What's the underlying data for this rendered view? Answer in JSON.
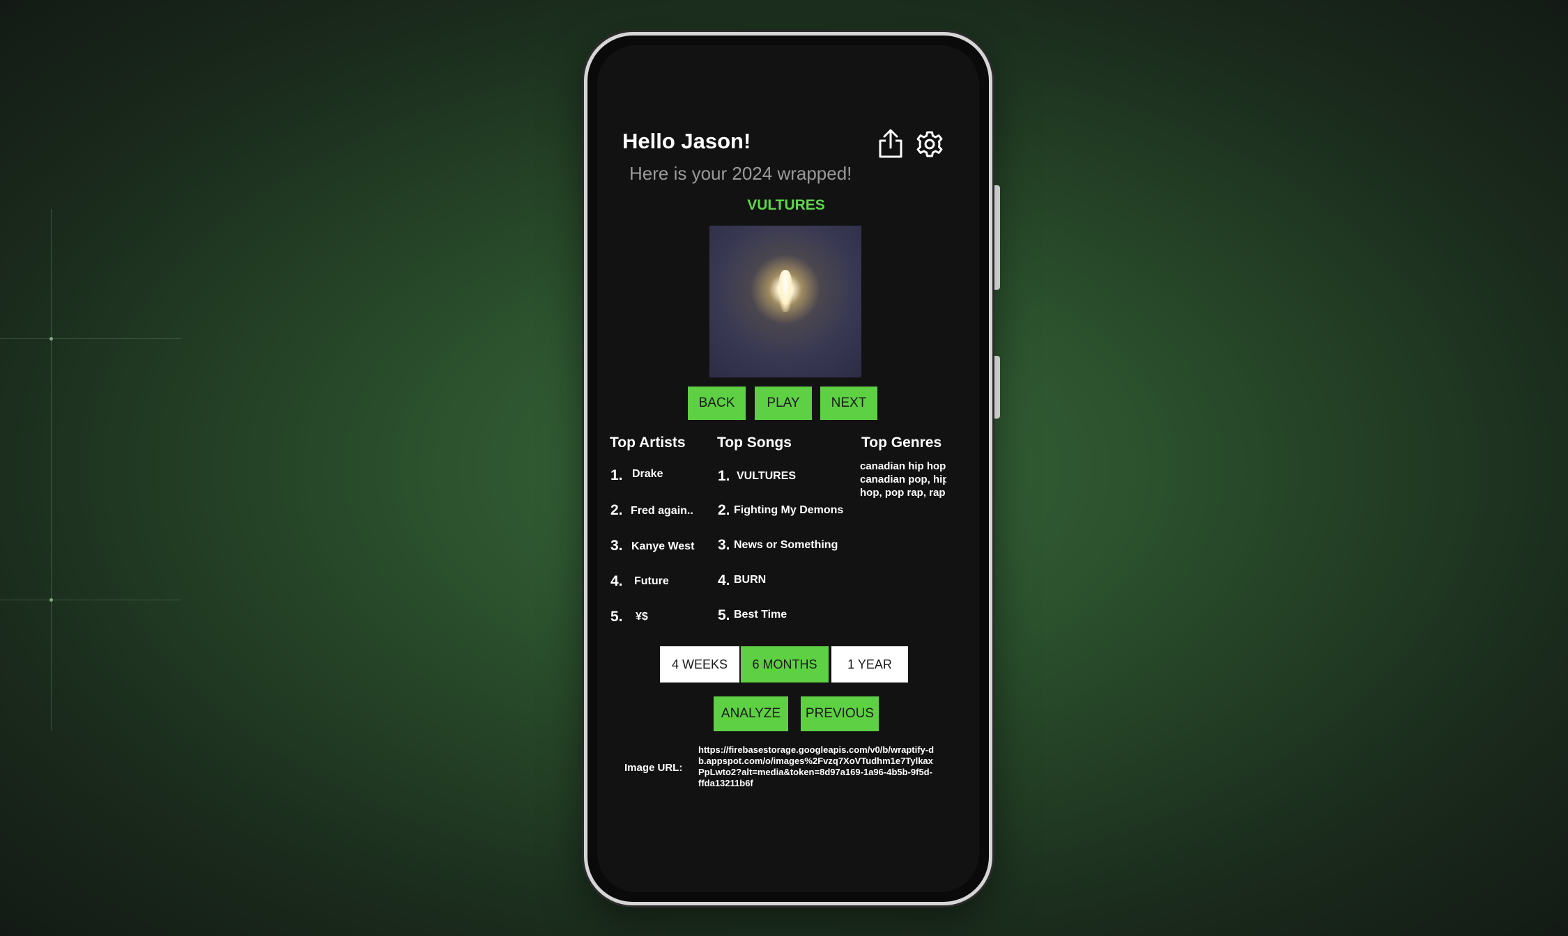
{
  "header": {
    "greeting": "Hello Jason!",
    "subtitle": "Here is your 2024 wrapped!",
    "share_icon": "share-icon",
    "settings_icon": "gear-icon"
  },
  "player": {
    "song_title": "VULTURES",
    "back_label": "BACK",
    "play_label": "PLAY",
    "next_label": "NEXT"
  },
  "top_artists": {
    "heading": "Top Artists",
    "items": [
      {
        "rank": "1.",
        "name": "Drake"
      },
      {
        "rank": "2.",
        "name": "Fred again.."
      },
      {
        "rank": "3.",
        "name": "Kanye West"
      },
      {
        "rank": "4.",
        "name": "Future"
      },
      {
        "rank": "5.",
        "name": "¥$"
      }
    ]
  },
  "top_songs": {
    "heading": "Top Songs",
    "items": [
      {
        "rank": "1.",
        "name": "VULTURES"
      },
      {
        "rank": "2.",
        "name": "Fighting My Demons"
      },
      {
        "rank": "3.",
        "name": "News or Something"
      },
      {
        "rank": "4.",
        "name": "BURN"
      },
      {
        "rank": "5.",
        "name": "Best Time"
      }
    ]
  },
  "top_genres": {
    "heading": "Top Genres",
    "text": "canadian hip hop,\ncanadian pop, hip\nhop, pop rap, rap"
  },
  "time_range": {
    "options": [
      "4 WEEKS",
      "6 MONTHS",
      "1 YEAR"
    ],
    "selected": "6 MONTHS"
  },
  "actions": {
    "analyze_label": "ANALYZE",
    "previous_label": "PREVIOUS"
  },
  "image_url": {
    "label": "Image URL:",
    "value": "https://firebasestorage.googleapis.com/v0/b/wraptify-db.appspot.com/o/images%2Fvzq7XoVTudhm1e7TylkaxPpLwto2?alt=media&token=8d97a169-1a96-4b5b-9f5d-ffda13211b6f"
  },
  "colors": {
    "accent": "#5ed043",
    "screen_bg": "#121212",
    "title_green": "#5fd84a"
  }
}
